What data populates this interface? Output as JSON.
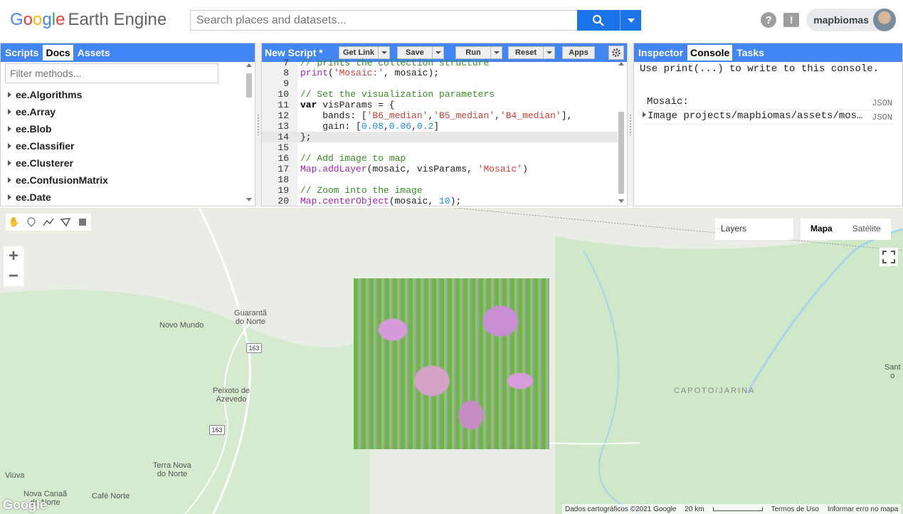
{
  "header": {
    "logo_parts": [
      "G",
      "o",
      "o",
      "g",
      "l",
      "e"
    ],
    "product": "Earth Engine",
    "search_placeholder": "Search places and datasets...",
    "help_icon": "?",
    "feedback_icon": "!",
    "username": "mapbiomas"
  },
  "left_panel": {
    "tabs": [
      "Scripts",
      "Docs",
      "Assets"
    ],
    "active_tab": "Docs",
    "filter_placeholder": "Filter methods...",
    "items": [
      "ee.Algorithms",
      "ee.Array",
      "ee.Blob",
      "ee.Classifier",
      "ee.Clusterer",
      "ee.ConfusionMatrix",
      "ee.Date"
    ]
  },
  "editor": {
    "title": "New Script *",
    "buttons": {
      "get_link": "Get Link",
      "save": "Save",
      "run": "Run",
      "reset": "Reset",
      "apps": "Apps"
    },
    "lines": [
      {
        "n": "7",
        "code": "// prints the collection structure"
      },
      {
        "n": "8",
        "code": "print('Mosaic:', mosaic);"
      },
      {
        "n": "9",
        "code": ""
      },
      {
        "n": "10",
        "code": "// Set the visualization parameters"
      },
      {
        "n": "11",
        "code": "var visParams = {"
      },
      {
        "n": "12",
        "code": "    bands: ['B6_median','B5_median','B4_median'],"
      },
      {
        "n": "13",
        "code": "    gain: [0.08,0.06,0.2]"
      },
      {
        "n": "14",
        "code": "};"
      },
      {
        "n": "15",
        "code": ""
      },
      {
        "n": "16",
        "code": "// Add image to map"
      },
      {
        "n": "17",
        "code": "Map.addLayer(mosaic, visParams, 'Mosaic')"
      },
      {
        "n": "18",
        "code": ""
      },
      {
        "n": "19",
        "code": "// Zoom into the image"
      },
      {
        "n": "20",
        "code": "Map.centerObject(mosaic, 10);"
      }
    ]
  },
  "right_panel": {
    "tabs": [
      "Inspector",
      "Console",
      "Tasks"
    ],
    "active_tab": "Console",
    "hint": "Use print(...) to write to this console.",
    "rows": [
      {
        "text": "Mosaic:",
        "tag": "JSON"
      },
      {
        "text": "Image projects/mapbiomas/assets/mos…",
        "tag": "JSON"
      }
    ]
  },
  "map": {
    "layers_label": "Layers",
    "map_types": [
      "Mapa",
      "Satélite"
    ],
    "active_map_type": "Mapa",
    "zoom_in": "+",
    "zoom_out": "−",
    "places": {
      "guaranta": "Guarantã\ndo Norte",
      "novo_mundo": "Novo Mundo",
      "peixoto": "Peixoto de\nAzevedo",
      "terra_nova": "Terra Nova\ndo Norte",
      "viuva": "Viúva",
      "nova_canaa": "Nova Canaã\ndo Norte",
      "cafe_norte": "Café Norte",
      "sant": "Sant\no"
    },
    "region": "CAPOTO/JARINA",
    "road_163a": "163",
    "road_163b": "163",
    "google": "Google",
    "attribution": {
      "data": "Dados cartográficos ©2021 Google",
      "scale": "20 km",
      "terms": "Termos de Uso",
      "report": "Informar erro no mapa"
    }
  }
}
